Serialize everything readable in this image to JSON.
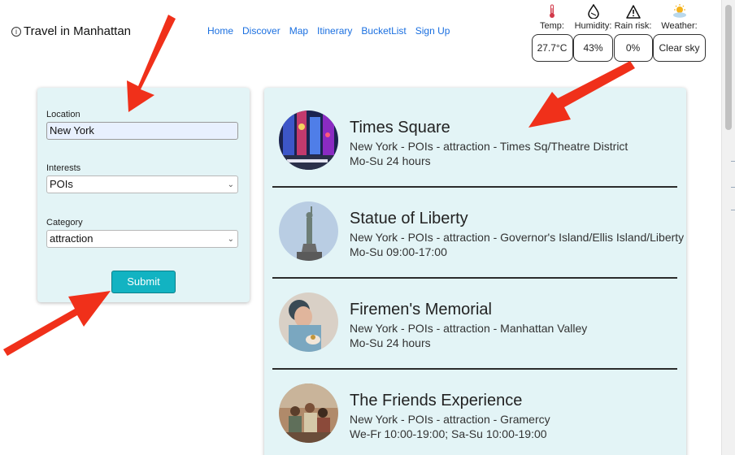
{
  "header": {
    "brand": "Travel in Manhattan",
    "brand_icon": "info-circle-icon",
    "nav": [
      "Home",
      "Discover",
      "Map",
      "Itinerary",
      "BucketList",
      "Sign Up"
    ]
  },
  "weather": {
    "temp": {
      "label": "Temp:",
      "value": "27.7°C",
      "icon": "thermometer-icon"
    },
    "humidity": {
      "label": "Humidity:",
      "value": "43%",
      "icon": "droplet-icon"
    },
    "rain": {
      "label": "Rain risk:",
      "value": "0%",
      "icon": "warning-icon"
    },
    "sky": {
      "label": "Weather:",
      "value": "Clear sky",
      "icon": "sun-cloud-icon"
    }
  },
  "form": {
    "location_label": "Location",
    "location_value": "New York",
    "interests_label": "Interests",
    "interests_value": "POIs",
    "category_label": "Category",
    "category_value": "attraction",
    "submit_label": "Submit"
  },
  "results": [
    {
      "title": "Times Square",
      "meta": "New York - POIs - attraction - Times Sq/Theatre District",
      "hours": "Mo-Su 24 hours"
    },
    {
      "title": "Statue of Liberty",
      "meta": "New York - POIs - attraction - Governor's Island/Ellis Island/Liberty Island",
      "hours": "Mo-Su 09:00-17:00"
    },
    {
      "title": "Firemen's Memorial",
      "meta": "New York - POIs - attraction - Manhattan Valley",
      "hours": "Mo-Su 24 hours"
    },
    {
      "title": "The Friends Experience",
      "meta": "New York - POIs - attraction - Gramercy",
      "hours": "We-Fr 10:00-19:00; Sa-Su 10:00-19:00"
    }
  ],
  "colors": {
    "accent": "#12b3c2",
    "link": "#1a6fe0",
    "panel": "#e3f4f6",
    "arrow": "#f0301a"
  }
}
